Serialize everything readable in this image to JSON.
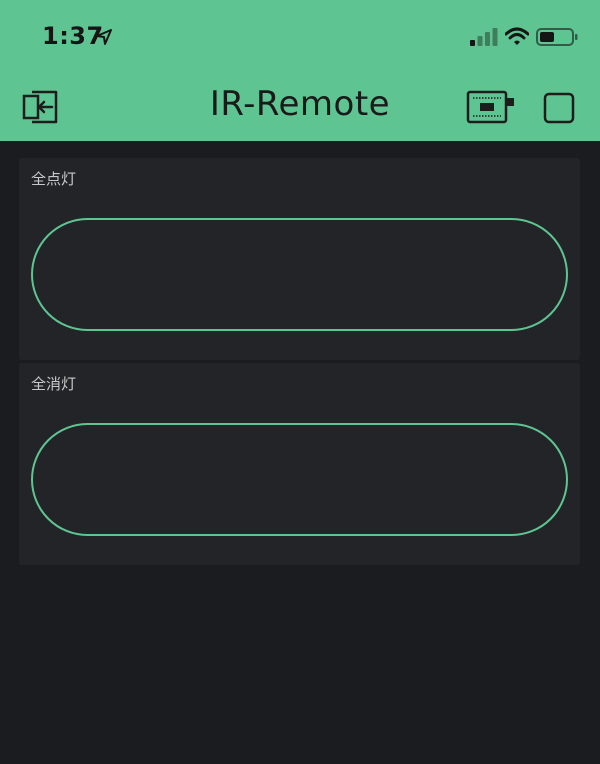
{
  "status_bar": {
    "time": "1:37",
    "icons": [
      "location-arrow-icon",
      "signal-bars-icon",
      "wifi-icon",
      "battery-icon"
    ]
  },
  "header": {
    "title": "IR-Remote",
    "background_color": "#5ec592",
    "icons": [
      "back-exit-icon",
      "device-board-icon",
      "stop-square-icon"
    ]
  },
  "widgets": [
    {
      "label": "全点灯",
      "button_label": ""
    },
    {
      "label": "全消灯",
      "button_label": ""
    }
  ],
  "colors": {
    "accent": "#5ec592",
    "background": "#1b1c1f",
    "widget_background": "#232427",
    "label_text": "#c9c9c9"
  }
}
